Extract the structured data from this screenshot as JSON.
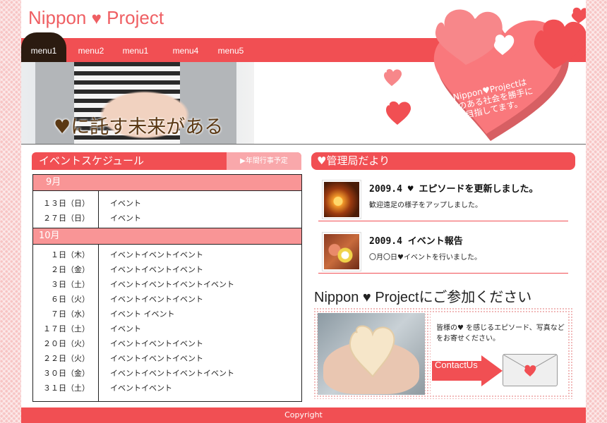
{
  "header": {
    "logo": {
      "part1": "Nippon",
      "heart": "♥",
      "part2": "Project"
    },
    "nav": [
      "menu1",
      "menu2",
      "menu1",
      "menu4",
      "menu5"
    ],
    "tagline": "♥に託す未来がある",
    "big_heart_text": "Nippon♥Projectは\n♥のある社会を勝手に\n目指してます。"
  },
  "schedule": {
    "title": "イベントスケジュール",
    "tab": "▶年間行事予定",
    "months": [
      {
        "label": "9月",
        "rows": [
          {
            "date": "１３日（日）",
            "event": "イベント"
          },
          {
            "date": "２７日（日）",
            "event": "イベント"
          }
        ]
      },
      {
        "label": "10月",
        "rows": [
          {
            "date": "１日（木）",
            "event": "イベントイベントイベント"
          },
          {
            "date": "２日（金）",
            "event": "イベントイベントイベント"
          },
          {
            "date": "３日（土）",
            "event": "イベントイベントイベントイベント"
          },
          {
            "date": "６日（火）",
            "event": "イベントイベントイベント"
          },
          {
            "date": "７日（水）",
            "event": "イベント イベント"
          },
          {
            "date": "１７日（土）",
            "event": "イベント"
          },
          {
            "date": "２０日（火）",
            "event": "イベントイベントイベント"
          },
          {
            "date": "２２日（火）",
            "event": "イベントイベントイベント"
          },
          {
            "date": "３０日（金）",
            "event": "イベントイベントイベントイベント"
          },
          {
            "date": "３１日（土）",
            "event": "イベントイベント"
          }
        ]
      }
    ]
  },
  "news": {
    "title": "♥管理局だより",
    "items": [
      {
        "title": "2009.4 ♥ エピソードを更新しました。",
        "body": "歓迎遠足の様子をアップしました。"
      },
      {
        "title": "2009.4 イベント報告",
        "body": "〇月〇日♥イベントを行いました。"
      }
    ]
  },
  "join": {
    "title": "Nippon ♥ Projectにご参加ください",
    "text": "皆様の♥ を感じるエピソード、写真などをお寄せください。",
    "contact_label": "ContactUs"
  },
  "footer": {
    "copyright": "Copyright"
  },
  "colors": {
    "accent": "#f14f53",
    "pink_light": "#f99596",
    "heart_pink": "#f9787c",
    "brown": "#5b3914"
  }
}
